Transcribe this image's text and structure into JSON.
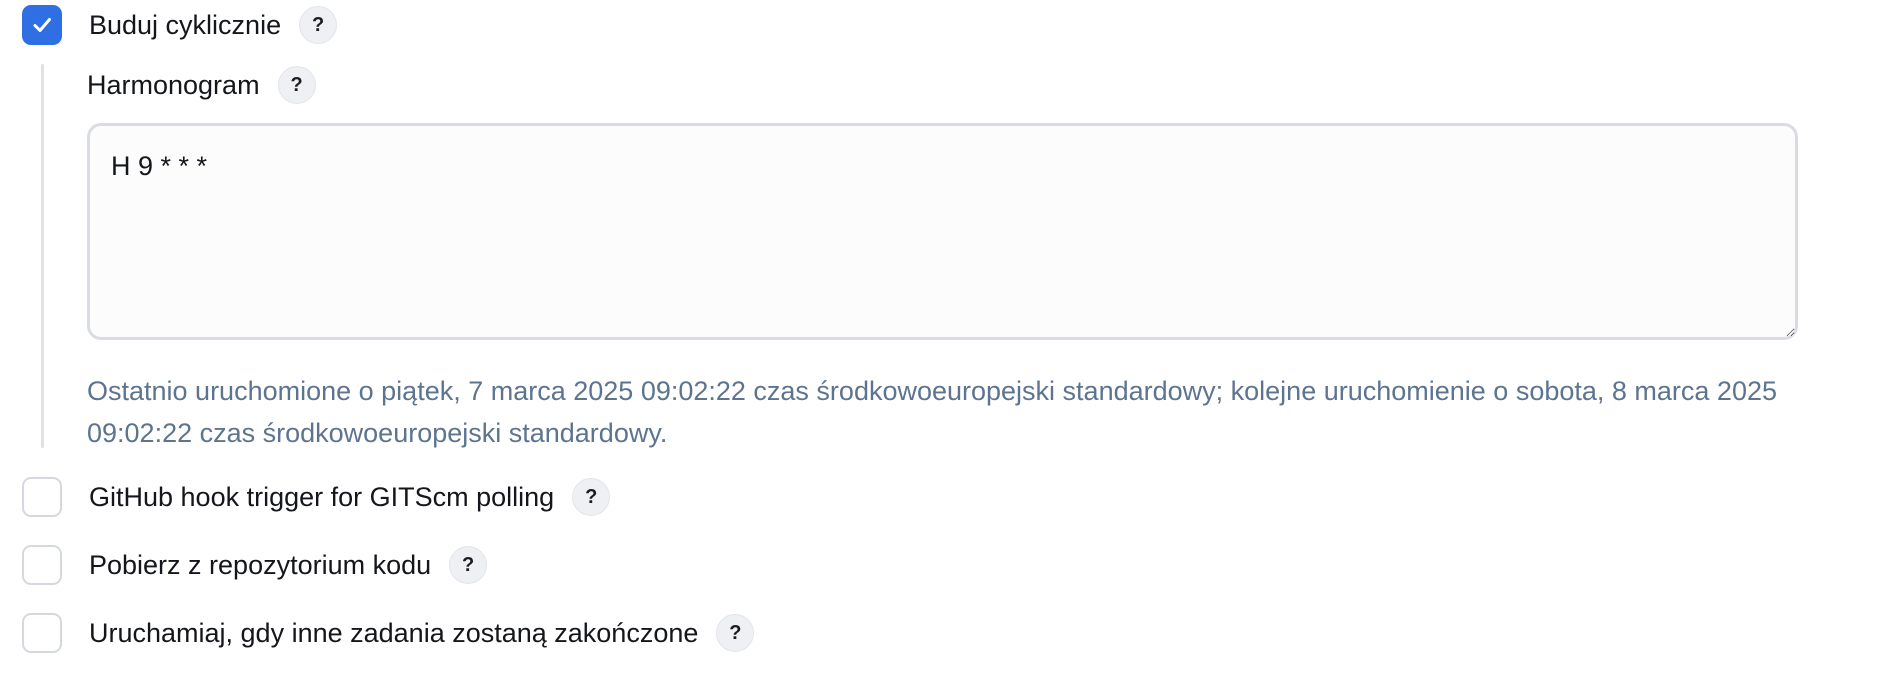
{
  "build_periodically": {
    "label": "Buduj cyklicznie",
    "checked": true,
    "help": "?",
    "schedule": {
      "label": "Harmonogram",
      "help": "?",
      "value": "H 9 * * *",
      "info": "Ostatnio uruchomione o piątek, 7 marca 2025 09:02:22 czas środkowoeuropejski standardowy; kolejne uruchomienie o sobota, 8 marca 2025 09:02:22 czas środkowoeuropejski standardowy."
    }
  },
  "triggers": [
    {
      "label": "GitHub hook trigger for GITScm polling",
      "checked": false,
      "help": "?"
    },
    {
      "label": "Pobierz z repozytorium kodu",
      "checked": false,
      "help": "?"
    },
    {
      "label": "Uruchamiaj, gdy inne zadania zostaną zakończone",
      "checked": false,
      "help": "?"
    }
  ],
  "icons": {
    "checkmark": "checkmark-icon",
    "resize": "resize-handle-icon"
  },
  "colors": {
    "accent": "#2f6fe4",
    "info_text": "#5d7490",
    "border": "#d5d9df"
  }
}
